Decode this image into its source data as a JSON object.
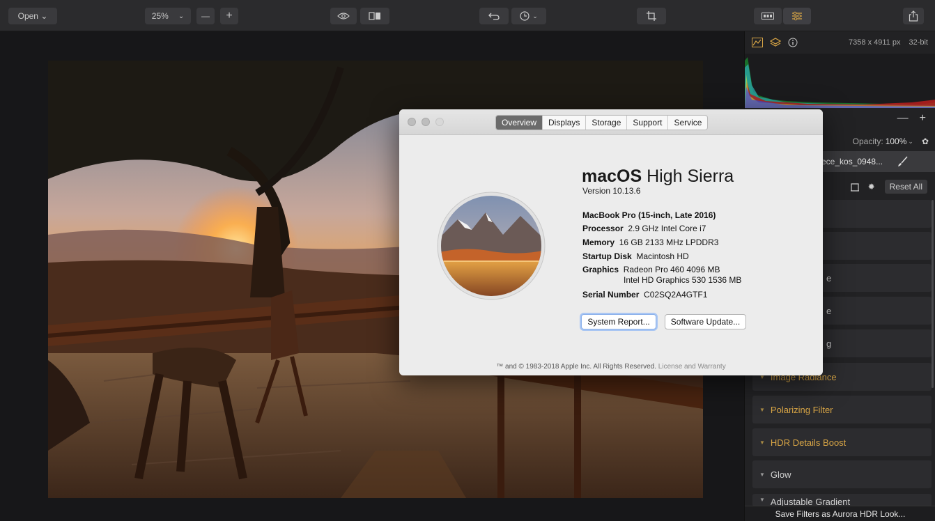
{
  "toolbar": {
    "open_label": "Open ⌄",
    "zoom_label": "25%",
    "zoom_menu_glyph": "⌄",
    "minus_glyph": "—",
    "plus_glyph": "+"
  },
  "panel": {
    "image_size": "7358 x 4911 px",
    "bit_depth": "32-bit",
    "layer_minus": "—",
    "layer_plus": "+",
    "opacity_label": "Opacity:",
    "opacity_value": "100%",
    "layer_name": "ece_kos_0948...",
    "reset_all": "Reset All",
    "partial_texts": [
      "e",
      "e",
      "g"
    ],
    "sections": [
      "Image Radiance",
      "Polarizing Filter",
      "HDR Details Boost",
      "Glow",
      "Adjustable Gradient"
    ],
    "save_filters": "Save Filters as Aurora HDR Look..."
  },
  "dialog": {
    "tabs": [
      "Overview",
      "Displays",
      "Storage",
      "Support",
      "Service"
    ],
    "selected_tab": "Overview",
    "os_bold": "macOS",
    "os_rest": "High Sierra",
    "version": "Version 10.13.6",
    "model": "MacBook Pro (15-inch, Late 2016)",
    "processor_label": "Processor",
    "processor_value": "2.9 GHz Intel Core i7",
    "memory_label": "Memory",
    "memory_value": "16 GB 2133 MHz LPDDR3",
    "disk_label": "Startup Disk",
    "disk_value": "Macintosh HD",
    "graphics_label": "Graphics",
    "graphics_value_1": "Radeon Pro 460 4096 MB",
    "graphics_value_2": "Intel HD Graphics 530 1536 MB",
    "serial_label": "Serial Number",
    "serial_value": "C02SQ2A4GTF1",
    "system_report_button": "System Report...",
    "software_update_button": "Software Update...",
    "copyright": "™ and © 1983-2018 Apple Inc. All Rights Reserved.",
    "license_link": "License and Warranty"
  },
  "colors": {
    "accent": "#d9a646",
    "panel_bg": "#222224",
    "toolbar_bg": "#2b2b2d"
  }
}
